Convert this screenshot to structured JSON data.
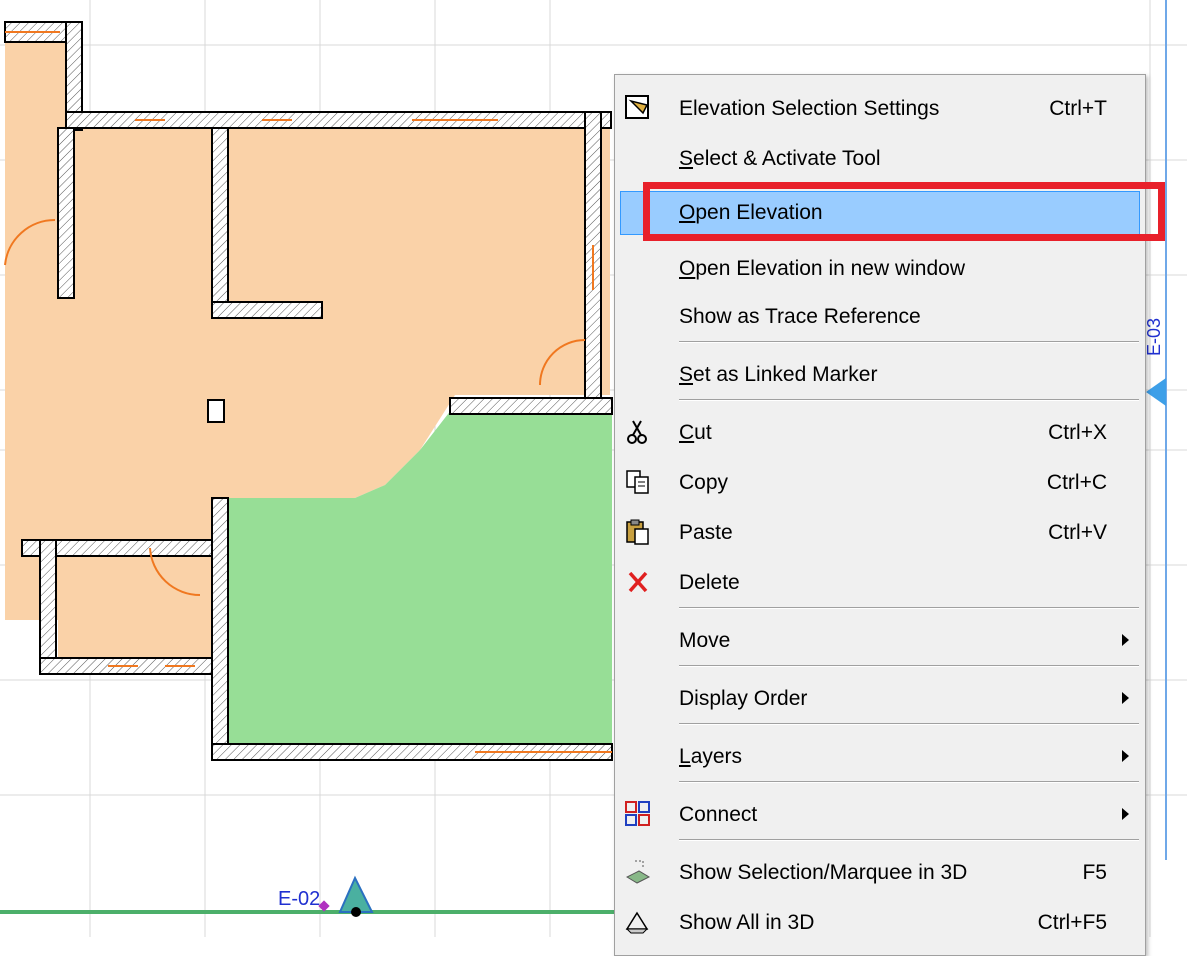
{
  "plan": {
    "marker_e02": "E-02",
    "marker_e03": "E-03"
  },
  "context_menu": {
    "items": [
      {
        "label": "Elevation Selection Settings",
        "shortcut": "Ctrl+T",
        "icon": "elevation-settings-icon"
      },
      {
        "label": "Select & Activate Tool",
        "accel_prefix": "",
        "accel_char": "S",
        "accel_rest": "elect & Activate Tool"
      },
      {
        "label": "Open Elevation",
        "accel_char": "O",
        "accel_rest": "pen Elevation",
        "highlighted": true
      },
      {
        "label": "Open Elevation in new window",
        "accel_char": "O",
        "accel_rest": "pen Elevation in new window"
      },
      {
        "label": "Show as Trace Reference"
      },
      {
        "label": "Set as Linked Marker",
        "accel_char": "S",
        "accel_rest": "et as Linked Marker"
      },
      {
        "label": "Cut",
        "accel_char": "C",
        "accel_rest": "ut",
        "shortcut": "Ctrl+X",
        "icon": "scissors-icon"
      },
      {
        "label": "Copy",
        "shortcut": "Ctrl+C",
        "icon": "copy-icon"
      },
      {
        "label": "Paste",
        "shortcut": "Ctrl+V",
        "icon": "paste-icon"
      },
      {
        "label": "Delete",
        "icon": "delete-x-icon"
      },
      {
        "label": "Move",
        "submenu": true
      },
      {
        "label": "Display Order",
        "submenu": true
      },
      {
        "label": "Layers",
        "accel_char": "L",
        "accel_rest": "ayers",
        "submenu": true
      },
      {
        "label": "Connect",
        "submenu": true,
        "icon": "connect-icon"
      },
      {
        "label": "Show Selection/Marquee in 3D",
        "shortcut": "F5",
        "icon": "show-selection-3d-icon"
      },
      {
        "label": "Show All in 3D",
        "shortcut": "Ctrl+F5",
        "icon": "show-all-3d-icon"
      }
    ]
  },
  "colors": {
    "room_orange": "#fad2a8",
    "room_green": "#97de96",
    "highlight": "#99ccff",
    "callout_red": "#e8202a",
    "marker_blue": "#3d9fe8"
  }
}
